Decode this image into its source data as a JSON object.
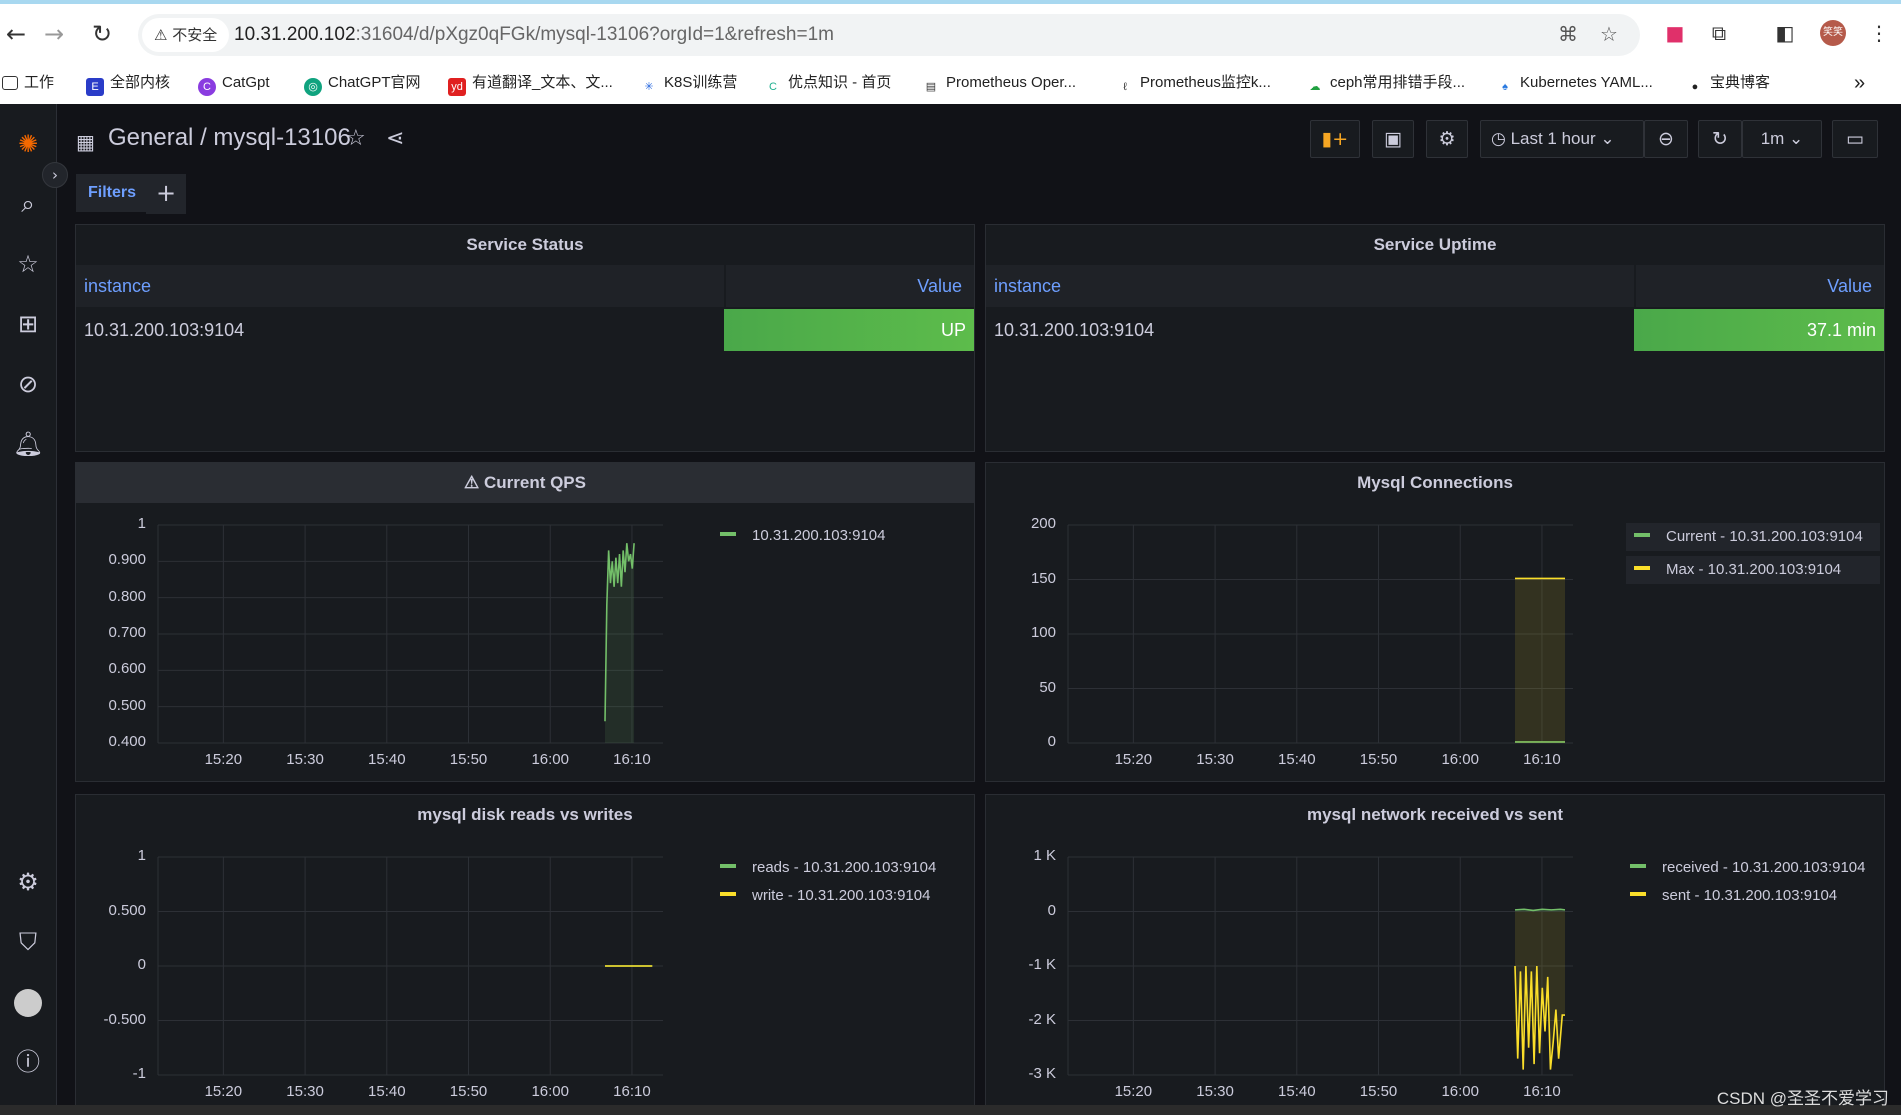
{
  "browser": {
    "insecure_label": "不安全",
    "url_host": "10.31.200.102",
    "url_rest": ":31604/d/pXgz0qFGk/mysql-13106?orgId=1&refresh=1m",
    "profile_initials": "笑笑",
    "bookmarks": [
      "工作",
      "全部内核",
      "CatGpt",
      "ChatGPT官网",
      "有道翻译_文本、文...",
      "K8S训练营",
      "优点知识 - 首页",
      "Prometheus Oper...",
      "Prometheus监控k...",
      "ceph常用排错手段...",
      "Kubernetes YAML...",
      "宝典博客"
    ],
    "overflow_label": "»"
  },
  "dashboard": {
    "folder": "General",
    "separator": "/",
    "name": "mysql-13106",
    "time_range": "Last 1 hour",
    "refresh": "1m",
    "filters_label": "Filters",
    "add_label": "+"
  },
  "panels": {
    "status": {
      "title": "Service Status",
      "col1": "instance",
      "col2": "Value",
      "instance": "10.31.200.103:9104",
      "value": "UP"
    },
    "uptime": {
      "title": "Service Uptime",
      "col1": "instance",
      "col2": "Value",
      "instance": "10.31.200.103:9104",
      "value": "37.1 min"
    },
    "qps": {
      "title": "Current QPS",
      "legend": [
        "10.31.200.103:9104"
      ]
    },
    "conn": {
      "title": "Mysql Connections",
      "legend": [
        "Current - 10.31.200.103:9104",
        "Max - 10.31.200.103:9104"
      ]
    },
    "disk": {
      "title": "mysql disk reads vs writes",
      "legend": [
        "reads - 10.31.200.103:9104",
        "write - 10.31.200.103:9104"
      ]
    },
    "net": {
      "title": "mysql network received vs sent",
      "legend": [
        "received - 10.31.200.103:9104",
        "sent - 10.31.200.103:9104"
      ]
    }
  },
  "colors": {
    "green": "#73bf69",
    "yellow": "#fade2a",
    "accent": "#6e9fff"
  },
  "chart_data": [
    {
      "type": "line",
      "title": "Current QPS",
      "x": [
        "15:20",
        "15:30",
        "15:40",
        "15:50",
        "16:00",
        "16:10"
      ],
      "yticks": [
        "1",
        "0.900",
        "0.800",
        "0.700",
        "0.600",
        "0.500",
        "0.400"
      ],
      "ylim": [
        0.4,
        1
      ],
      "series": [
        {
          "name": "10.31.200.103:9104",
          "points": [
            [
              16.0,
              0.46
            ],
            [
              16.02,
              0.78
            ],
            [
              16.04,
              0.93
            ],
            [
              16.06,
              0.84
            ],
            [
              16.08,
              0.9
            ],
            [
              16.1,
              0.83
            ],
            [
              16.12,
              0.91
            ],
            [
              16.14,
              0.84
            ],
            [
              16.16,
              0.92
            ],
            [
              16.18,
              0.83
            ],
            [
              16.2,
              0.93
            ],
            [
              16.22,
              0.87
            ],
            [
              16.24,
              0.95
            ],
            [
              16.26,
              0.9
            ],
            [
              16.28,
              0.92
            ],
            [
              16.3,
              0.88
            ],
            [
              16.32,
              0.95
            ]
          ]
        }
      ]
    },
    {
      "type": "line",
      "title": "Mysql Connections",
      "x": [
        "15:20",
        "15:30",
        "15:40",
        "15:50",
        "16:00",
        "16:10"
      ],
      "yticks": [
        "200",
        "150",
        "100",
        "50",
        "0"
      ],
      "ylim": [
        0,
        200
      ],
      "series": [
        {
          "name": "Current - 10.31.200.103:9104",
          "points": [
            [
              16.0,
              1
            ],
            [
              16.55,
              1
            ]
          ]
        },
        {
          "name": "Max - 10.31.200.103:9104",
          "points": [
            [
              16.0,
              151
            ],
            [
              16.55,
              151
            ]
          ]
        }
      ]
    },
    {
      "type": "line",
      "title": "mysql disk reads vs writes",
      "x": [
        "15:20",
        "15:30",
        "15:40",
        "15:50",
        "16:00",
        "16:10"
      ],
      "yticks": [
        "1",
        "0.500",
        "0",
        "-0.500",
        "-1"
      ],
      "ylim": [
        -1,
        1
      ],
      "series": [
        {
          "name": "reads - 10.31.200.103:9104",
          "points": [
            [
              16.0,
              0
            ],
            [
              16.52,
              0
            ]
          ]
        },
        {
          "name": "write - 10.31.200.103:9104",
          "points": [
            [
              16.0,
              0
            ],
            [
              16.52,
              0
            ]
          ]
        }
      ]
    },
    {
      "type": "line",
      "title": "mysql network received vs sent",
      "x": [
        "15:20",
        "15:30",
        "15:40",
        "15:50",
        "16:00",
        "16:10"
      ],
      "yticks": [
        "1 K",
        "0",
        "-1 K",
        "-2 K",
        "-3 K"
      ],
      "ylim": [
        -3000,
        1000
      ],
      "series": [
        {
          "name": "received - 10.31.200.103:9104",
          "points": [
            [
              16.0,
              30
            ],
            [
              16.1,
              40
            ],
            [
              16.2,
              20
            ],
            [
              16.3,
              40
            ],
            [
              16.4,
              30
            ],
            [
              16.5,
              40
            ],
            [
              16.55,
              30
            ]
          ]
        },
        {
          "name": "sent - 10.31.200.103:9104",
          "points": [
            [
              16.0,
              -1000
            ],
            [
              16.03,
              -2700
            ],
            [
              16.06,
              -1100
            ],
            [
              16.09,
              -2900
            ],
            [
              16.12,
              -1000
            ],
            [
              16.15,
              -2500
            ],
            [
              16.18,
              -1100
            ],
            [
              16.21,
              -2800
            ],
            [
              16.24,
              -1000
            ],
            [
              16.27,
              -2600
            ],
            [
              16.3,
              -1400
            ],
            [
              16.33,
              -2200
            ],
            [
              16.36,
              -1200
            ],
            [
              16.39,
              -2900
            ],
            [
              16.42,
              -2400
            ],
            [
              16.45,
              -1800
            ],
            [
              16.48,
              -2700
            ],
            [
              16.52,
              -1900
            ],
            [
              16.55,
              -1900
            ]
          ]
        }
      ]
    }
  ],
  "footer": {
    "watermark": "CSDN @圣圣不爱学习"
  }
}
